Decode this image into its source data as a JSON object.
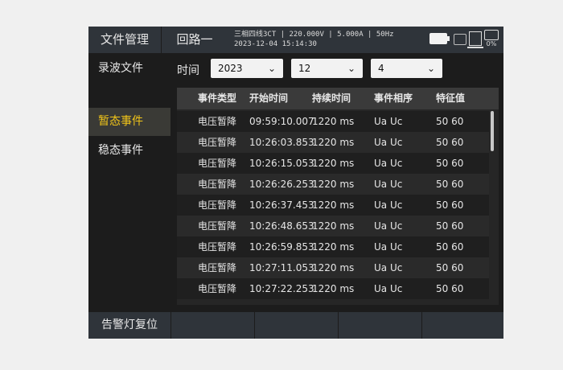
{
  "header": {
    "tab_file": "文件管理",
    "tab_loop": "回路一",
    "status_line1": "三相四线3CT | 220.000V | 5.000A | 50Hz",
    "status_line2": "2023-12-04 15:14:30",
    "storage_percent": "0%"
  },
  "sidebar": {
    "items": [
      {
        "label": "录波文件"
      },
      {
        "label": "暂态事件"
      },
      {
        "label": "稳态事件"
      }
    ]
  },
  "filter": {
    "time_label": "时间",
    "year": "2023",
    "month": "12",
    "day": "4"
  },
  "table": {
    "headers": [
      "事件类型",
      "开始时间",
      "持续时间",
      "事件相序",
      "特征值"
    ],
    "rows": [
      [
        "电压暂降",
        "09:59:10.007",
        "1220 ms",
        "Ua Uc",
        "50 60"
      ],
      [
        "电压暂降",
        "10:26:03.853",
        "1220 ms",
        "Ua Uc",
        "50 60"
      ],
      [
        "电压暂降",
        "10:26:15.053",
        "1220 ms",
        "Ua Uc",
        "50 60"
      ],
      [
        "电压暂降",
        "10:26:26.253",
        "1220 ms",
        "Ua Uc",
        "50 60"
      ],
      [
        "电压暂降",
        "10:26:37.453",
        "1220 ms",
        "Ua Uc",
        "50 60"
      ],
      [
        "电压暂降",
        "10:26:48.653",
        "1220 ms",
        "Ua Uc",
        "50 60"
      ],
      [
        "电压暂降",
        "10:26:59.853",
        "1220 ms",
        "Ua Uc",
        "50 60"
      ],
      [
        "电压暂降",
        "10:27:11.053",
        "1220 ms",
        "Ua Uc",
        "50 60"
      ],
      [
        "电压暂降",
        "10:27:22.253",
        "1220 ms",
        "Ua Uc",
        "50 60"
      ]
    ]
  },
  "softkeys": {
    "k0": "告警灯复位",
    "k1": "",
    "k2": "",
    "k3": "",
    "k4": ""
  },
  "icons": {
    "chevron": "⌄"
  },
  "colors": {
    "accent": "#f0c419",
    "bar_bg": "#2f343a",
    "screen_bg": "#1c1c1c"
  }
}
